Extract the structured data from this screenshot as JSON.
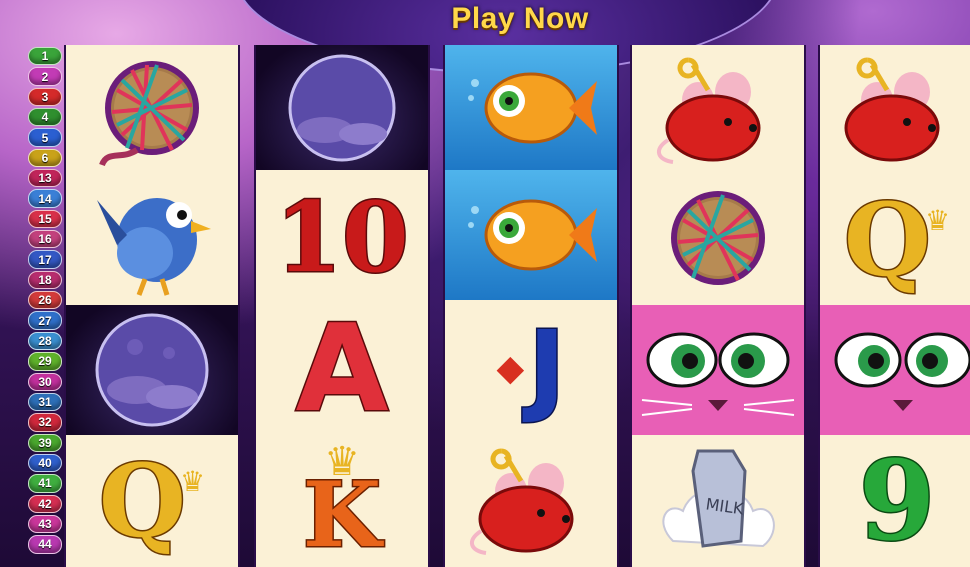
{
  "header": {
    "play_now_label": "Play Now"
  },
  "paylines": [
    {
      "label": "1",
      "color": "#3aa43a"
    },
    {
      "label": "2",
      "color": "#c23bb5"
    },
    {
      "label": "3",
      "color": "#d42a2a"
    },
    {
      "label": "4",
      "color": "#2f8f2f"
    },
    {
      "label": "5",
      "color": "#2b5fd1"
    },
    {
      "label": "6",
      "color": "#c9a21a"
    },
    {
      "label": "13",
      "color": "#c0245a"
    },
    {
      "label": "14",
      "color": "#3a7fd6"
    },
    {
      "label": "15",
      "color": "#d8304a"
    },
    {
      "label": "16",
      "color": "#c2417d"
    },
    {
      "label": "17",
      "color": "#3358c4"
    },
    {
      "label": "18",
      "color": "#b72d6e"
    },
    {
      "label": "26",
      "color": "#d23a3a"
    },
    {
      "label": "27",
      "color": "#2f6fc9"
    },
    {
      "label": "28",
      "color": "#3a8fd0"
    },
    {
      "label": "29",
      "color": "#5fb22b"
    },
    {
      "label": "30",
      "color": "#c2309d"
    },
    {
      "label": "31",
      "color": "#2d6fb8"
    },
    {
      "label": "32",
      "color": "#d0283c"
    },
    {
      "label": "39",
      "color": "#4aa82e"
    },
    {
      "label": "40",
      "color": "#2f5fcc"
    },
    {
      "label": "41",
      "color": "#3fae3f"
    },
    {
      "label": "42",
      "color": "#d42e52"
    },
    {
      "label": "43",
      "color": "#c9369a"
    },
    {
      "label": "44",
      "color": "#b838b0"
    }
  ],
  "reels": {
    "reel1": [
      "Yarn Ball",
      "Bird",
      "Moon",
      "Q"
    ],
    "reel2": [
      "Moon",
      "10",
      "A",
      "K"
    ],
    "reel3": [
      "Goldfish",
      "Goldfish",
      "J",
      "Mouse"
    ],
    "reel4": [
      "Mouse",
      "Yarn Ball",
      "Miss Kitty",
      "Milk"
    ],
    "reel5": [
      "Mouse",
      "Q",
      "Miss Kitty",
      "9"
    ]
  },
  "symbol_text": {
    "ten": "10",
    "ace": "A",
    "king": "K",
    "jack": "J",
    "queen": "Q",
    "nine": "9",
    "milk": "MILK"
  },
  "colors": {
    "reel_bg": "#fbf1d6",
    "play_now": "#ffd84a",
    "ten": "#c81a1a",
    "ace": "#e0303a",
    "king": "#e8641a",
    "jack": "#1e3cb0",
    "queen": "#e8b423",
    "nine": "#27a83a"
  }
}
